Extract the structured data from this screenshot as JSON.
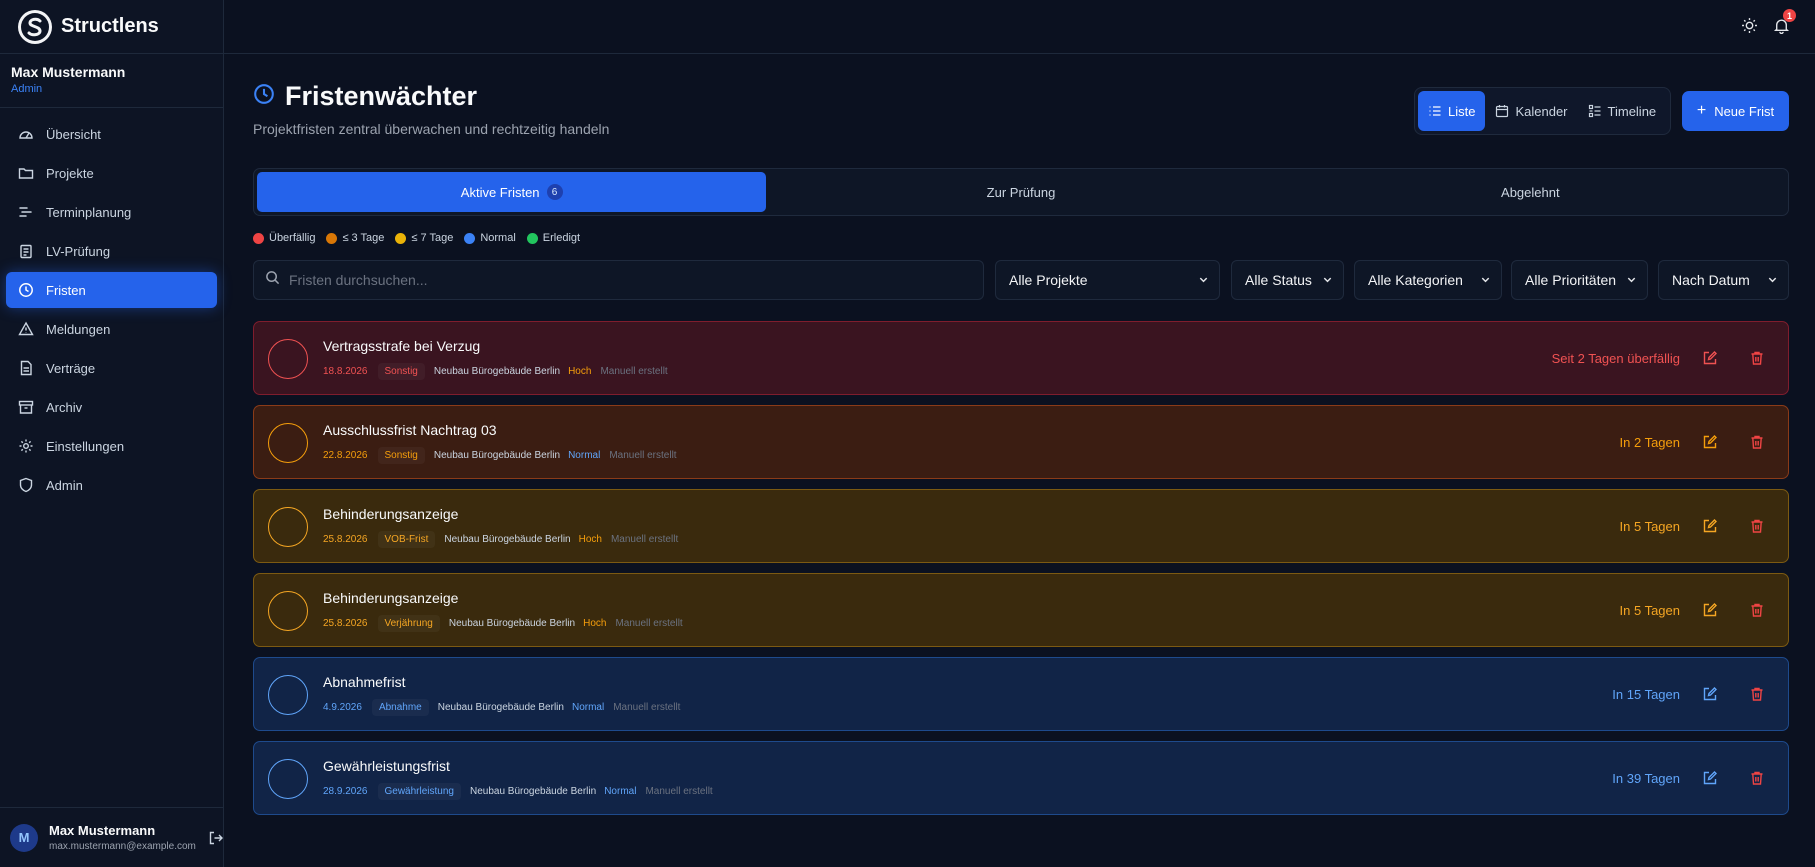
{
  "app": {
    "name": "Structlens"
  },
  "user": {
    "name": "Max Mustermann",
    "role": "Admin",
    "email": "max.mustermann@example.com",
    "initial": "M"
  },
  "nav": [
    {
      "label": "Übersicht",
      "icon": "dashboard-icon"
    },
    {
      "label": "Projekte",
      "icon": "folder-icon"
    },
    {
      "label": "Terminplanung",
      "icon": "gantt-icon"
    },
    {
      "label": "LV-Prüfung",
      "icon": "clipboard-icon"
    },
    {
      "label": "Fristen",
      "icon": "clock-icon",
      "active": true
    },
    {
      "label": "Meldungen",
      "icon": "warning-icon"
    },
    {
      "label": "Verträge",
      "icon": "document-icon"
    },
    {
      "label": "Archiv",
      "icon": "archive-icon"
    },
    {
      "label": "Einstellungen",
      "icon": "gear-icon"
    },
    {
      "label": "Admin",
      "icon": "shield-icon"
    }
  ],
  "topbar": {
    "notification_count": "1"
  },
  "page": {
    "title": "Fristenwächter",
    "subtitle": "Projektfristen zentral überwachen und rechtzeitig handeln"
  },
  "views": {
    "list": "Liste",
    "calendar": "Kalender",
    "timeline": "Timeline",
    "active": "Liste"
  },
  "new_button": "Neue Frist",
  "tabs": [
    {
      "label": "Aktive Fristen",
      "count": "6",
      "active": true
    },
    {
      "label": "Zur Prüfung"
    },
    {
      "label": "Abgelehnt"
    }
  ],
  "legend": [
    {
      "label": "Überfällig",
      "color": "#ef4444"
    },
    {
      "label": "≤ 3 Tage",
      "color": "#f97316"
    },
    {
      "label": "≤ 7 Tage",
      "color": "#eab308"
    },
    {
      "label": "Normal",
      "color": "#3b82f6"
    },
    {
      "label": "Erledigt",
      "color": "#22c55e"
    }
  ],
  "search": {
    "placeholder": "Fristen durchsuchen..."
  },
  "filters": {
    "projects": "Alle Projekte",
    "status": "Alle Status",
    "categories": "Alle Kategorien",
    "priorities": "Alle Prioritäten",
    "sort": "Nach Datum"
  },
  "deadlines": [
    {
      "title": "Vertragsstrafe bei Verzug",
      "date": "18.8.2026",
      "category": "Sonstig",
      "project": "Neubau Bürogebäude Berlin",
      "priority": "Hoch",
      "source": "Manuell erstellt",
      "status": "Seit 2 Tagen überfällig",
      "tone": "red"
    },
    {
      "title": "Ausschlussfrist Nachtrag 03",
      "date": "22.8.2026",
      "category": "Sonstig",
      "project": "Neubau Bürogebäude Berlin",
      "priority": "Normal",
      "source": "Manuell erstellt",
      "status": "In 2 Tagen",
      "tone": "orange"
    },
    {
      "title": "Behinderungsanzeige",
      "date": "25.8.2026",
      "category": "VOB-Frist",
      "project": "Neubau Bürogebäude Berlin",
      "priority": "Hoch",
      "source": "Manuell erstellt",
      "status": "In 5 Tagen",
      "tone": "yellow"
    },
    {
      "title": "Behinderungsanzeige",
      "date": "25.8.2026",
      "category": "Verjährung",
      "project": "Neubau Bürogebäude Berlin",
      "priority": "Hoch",
      "source": "Manuell erstellt",
      "status": "In 5 Tagen",
      "tone": "yellow"
    },
    {
      "title": "Abnahmefrist",
      "date": "4.9.2026",
      "category": "Abnahme",
      "project": "Neubau Bürogebäude Berlin",
      "priority": "Normal",
      "source": "Manuell erstellt",
      "status": "In 15 Tagen",
      "tone": "blue"
    },
    {
      "title": "Gewährleistungsfrist",
      "date": "28.9.2026",
      "category": "Gewährleistung",
      "project": "Neubau Bürogebäude Berlin",
      "priority": "Normal",
      "source": "Manuell erstellt",
      "status": "In 39 Tagen",
      "tone": "blue"
    }
  ],
  "colors": {
    "accent": "#2563eb",
    "red": "#f05252",
    "orange": "#f59e0b",
    "yellow": "#f5a623",
    "blue": "#60a5fa",
    "priority_high": "#f59e0b",
    "priority_normal": "#60a5fa",
    "delete": "#ef4444"
  }
}
